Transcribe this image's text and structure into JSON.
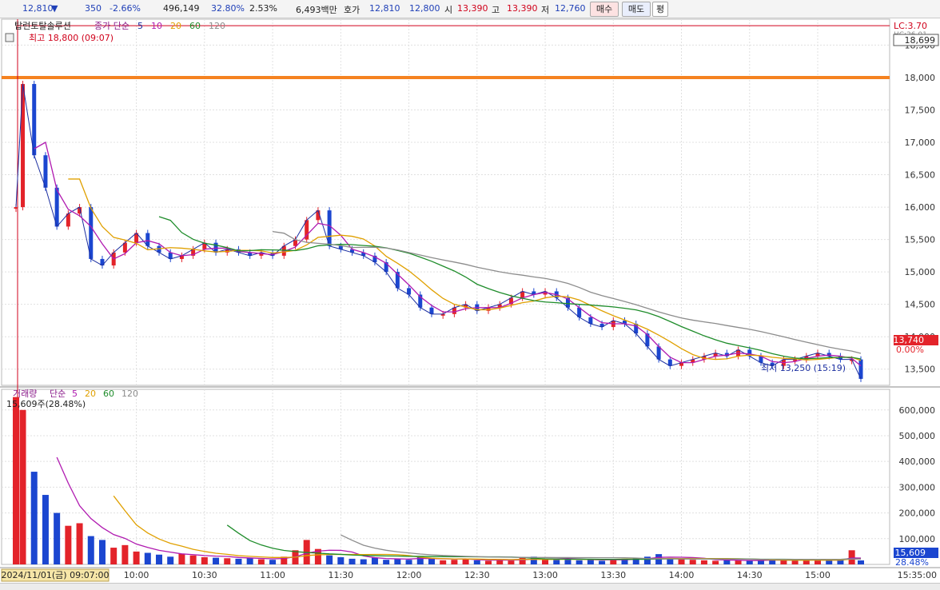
{
  "quote": {
    "price": "12,810",
    "arrow": "▼",
    "change": "350",
    "change_rate": "-2.66%",
    "volume": "496,149",
    "volume_ratio": "32.80%",
    "turnover_rate": "2.53%",
    "amount": "6,493백만",
    "hoga_label": "호가",
    "ask": "12,810",
    "bid": "12,800",
    "open_label": "시",
    "open": "13,390",
    "high_label": "고",
    "high": "13,390",
    "low_label": "저",
    "low": "12,760",
    "buy_button": "매수",
    "sell_button": "매도",
    "third_button": "평"
  },
  "colors": {
    "up": "#e3232a",
    "down": "#1b46d0",
    "ma5": "#1b2ea0",
    "ma10": "#b01ab0",
    "ma20": "#e0a000",
    "ma60": "#1e8c2a",
    "ma120": "#8c8c8c",
    "resistance_line": "#f58220",
    "high_line": "#d0021b"
  },
  "price_panel": {
    "title": "탑런토탈솔루션",
    "ma_label": "종가 단순",
    "ma_periods": [
      "5",
      "10",
      "20",
      "60",
      "120"
    ],
    "high_annotation": "최고 18,800 (09:07)",
    "low_annotation": "최저 13,250 (15:19)",
    "lc_label": "LC:3.70",
    "hc_label": "HC:26.01",
    "current_tag": "18,699",
    "last_tag": "13,740",
    "pct_tag": "0.00%",
    "icon": "grid-icon"
  },
  "volume_panel": {
    "title": "거래량",
    "ma_label": "단순",
    "ma_periods": [
      "5",
      "20",
      "60",
      "120"
    ],
    "current": "15,609주(28.48%)",
    "last_tag": "15,609",
    "pct_tag": "28.48%"
  },
  "time_axis": {
    "start_label": "2024/11/01(금) 09:07:00",
    "end_label": "15:35:00"
  },
  "chart_data": [
    {
      "type": "line",
      "title": "탑런토탈솔루션",
      "y_axis_ticks": [
        "13,500",
        "14,000",
        "14,500",
        "15,000",
        "15,500",
        "16,000",
        "16,500",
        "17,000",
        "17,500",
        "18,000",
        "18,500"
      ],
      "x_axis_ticks": [
        "10:00",
        "10:30",
        "11:00",
        "11:30",
        "12:00",
        "12:30",
        "13:00",
        "13:30",
        "14:00",
        "14:30",
        "15:00"
      ],
      "ylim": [
        13250,
        18900
      ],
      "series": [
        {
          "name": "종가",
          "x": [
            "09:07",
            "09:10",
            "09:15",
            "09:20",
            "09:25",
            "09:30",
            "09:35",
            "09:40",
            "09:45",
            "09:50",
            "09:55",
            "10:00",
            "10:05",
            "10:10",
            "10:15",
            "10:20",
            "10:25",
            "10:30",
            "10:35",
            "10:40",
            "10:45",
            "10:50",
            "10:55",
            "11:00",
            "11:05",
            "11:10",
            "11:15",
            "11:20",
            "11:25",
            "11:30",
            "11:35",
            "11:40",
            "11:45",
            "11:50",
            "11:55",
            "12:00",
            "12:05",
            "12:10",
            "12:15",
            "12:20",
            "12:25",
            "12:30",
            "12:35",
            "12:40",
            "12:45",
            "12:50",
            "12:55",
            "13:00",
            "13:05",
            "13:10",
            "13:15",
            "13:20",
            "13:25",
            "13:30",
            "13:35",
            "13:40",
            "13:45",
            "13:50",
            "13:55",
            "14:00",
            "14:05",
            "14:10",
            "14:15",
            "14:20",
            "14:25",
            "14:30",
            "14:35",
            "14:40",
            "14:45",
            "14:50",
            "14:55",
            "15:00",
            "15:05",
            "15:10",
            "15:15",
            "15:19"
          ],
          "values": [
            16000,
            17900,
            16800,
            16300,
            15700,
            15900,
            16000,
            15200,
            15100,
            15300,
            15450,
            15600,
            15400,
            15300,
            15200,
            15250,
            15350,
            15450,
            15300,
            15350,
            15300,
            15250,
            15300,
            15250,
            15400,
            15500,
            15800,
            15950,
            15400,
            15350,
            15300,
            15250,
            15150,
            15000,
            14750,
            14650,
            14450,
            14350,
            14350,
            14450,
            14500,
            14400,
            14450,
            14500,
            14600,
            14700,
            14650,
            14700,
            14600,
            14450,
            14300,
            14200,
            14150,
            14250,
            14200,
            14050,
            13850,
            13650,
            13550,
            13600,
            13650,
            13700,
            13750,
            13700,
            13800,
            13700,
            13600,
            13550,
            13650,
            13650,
            13700,
            13750,
            13700,
            13650,
            13650,
            13350
          ]
        }
      ],
      "reference_lines": [
        {
          "name": "resistance",
          "value": 18000
        }
      ],
      "annotations": [
        "최고 18,800 (09:07)",
        "최저 13,250 (15:19)"
      ]
    },
    {
      "type": "bar",
      "title": "거래량",
      "y_axis_ticks": [
        "100,000",
        "200,000",
        "300,000",
        "400,000",
        "500,000",
        "600,000"
      ],
      "ylim": [
        0,
        680000
      ],
      "x": [
        "09:07",
        "09:10",
        "09:15",
        "09:20",
        "09:25",
        "09:30",
        "09:35",
        "09:40",
        "09:45",
        "09:50",
        "09:55",
        "10:00",
        "10:05",
        "10:10",
        "10:15",
        "10:20",
        "10:25",
        "10:30",
        "10:35",
        "10:40",
        "10:45",
        "10:50",
        "10:55",
        "11:00",
        "11:05",
        "11:10",
        "11:15",
        "11:20",
        "11:25",
        "11:30",
        "11:35",
        "11:40",
        "11:45",
        "11:50",
        "11:55",
        "12:00",
        "12:05",
        "12:10",
        "12:15",
        "12:20",
        "12:25",
        "12:30",
        "12:35",
        "12:40",
        "12:45",
        "12:50",
        "12:55",
        "13:00",
        "13:05",
        "13:10",
        "13:15",
        "13:20",
        "13:25",
        "13:30",
        "13:35",
        "13:40",
        "13:45",
        "13:50",
        "13:55",
        "14:00",
        "14:05",
        "14:10",
        "14:15",
        "14:20",
        "14:25",
        "14:30",
        "14:35",
        "14:40",
        "14:45",
        "14:50",
        "14:55",
        "15:00",
        "15:05",
        "15:10",
        "15:15",
        "15:19"
      ],
      "values": [
        650000,
        600000,
        360000,
        270000,
        200000,
        150000,
        160000,
        110000,
        95000,
        65000,
        75000,
        50000,
        45000,
        38000,
        30000,
        42000,
        35000,
        28000,
        26000,
        24000,
        22000,
        25000,
        20000,
        18000,
        30000,
        55000,
        95000,
        60000,
        35000,
        28000,
        22000,
        20000,
        26000,
        18000,
        22000,
        18000,
        32000,
        22000,
        16000,
        18000,
        20000,
        16000,
        14000,
        18000,
        15000,
        25000,
        30000,
        20000,
        18000,
        22000,
        16000,
        18000,
        14000,
        20000,
        22000,
        25000,
        30000,
        40000,
        25000,
        20000,
        18000,
        16000,
        14000,
        18000,
        15000,
        14000,
        16000,
        20000,
        18000,
        14000,
        16000,
        18000,
        16000,
        20000,
        55000,
        15609
      ]
    }
  ]
}
